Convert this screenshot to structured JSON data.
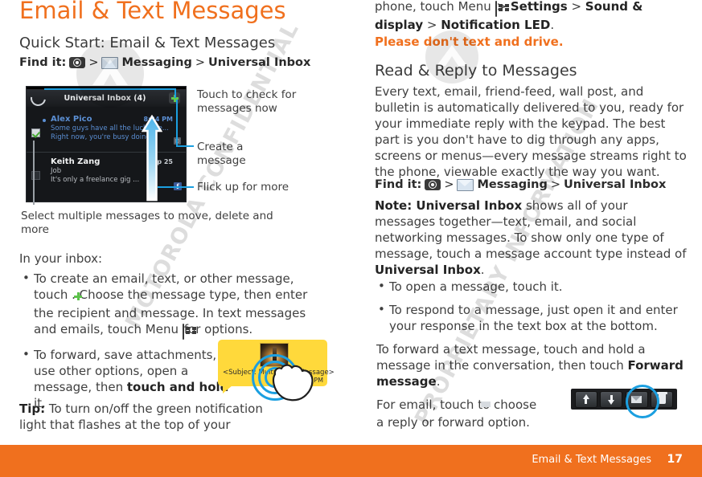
{
  "page": {
    "title": "Email & Text Messages",
    "subtitle": "Quick Start: Email & Text Messages",
    "accent_color": "#F0701E"
  },
  "left": {
    "find_it_label": "Find it:",
    "find_it_sep1": ">",
    "find_it_app": "Messaging",
    "find_it_sep2": ">",
    "find_it_target": "Universal Inbox",
    "phone": {
      "header_title": "Universal Inbox (4)",
      "refresh_icon": "refresh-icon",
      "compose_icon": "plus-icon",
      "messages": [
        {
          "from": "Alex Pico",
          "line2": "Some guys have all the luck, me...",
          "line3": "Right now, you're busy doing...",
          "time": "8:34 PM",
          "unread": true,
          "checked": true,
          "badge": "attachment-badge"
        },
        {
          "from": "Keith Zang",
          "line2": "Job",
          "line3": "It's only a freelance gig ...",
          "time": "Sep 25",
          "unread": false,
          "checked": false,
          "badge": "facebook-badge"
        }
      ]
    },
    "callouts": [
      "Touch to check for messages now",
      "Create a message",
      "Flick up for more",
      "Select multiple messages to move, delete and more"
    ],
    "inbox_intro": "In your inbox:",
    "bullets": [
      {
        "pre": "To create an email, text, or other message, touch ",
        "icon": "plus-icon",
        "mid": ". Choose the message type, then enter the recipient and message. In text messages and emails, touch Menu ",
        "icon2": "menu-icon",
        "post": " for options."
      },
      {
        "pre": "To forward, save attachments, or use other options, open a message, then ",
        "bold": "touch and hold",
        "post": " it."
      }
    ],
    "tip_label": "Tip:",
    "tip_text": " To turn on/off the green notification light that flashes at the top of your",
    "bubble": {
      "subject": "<Subject: Multimedia Message>",
      "time": "8:30 PM",
      "thumb": "lighthouse-thumbnail"
    }
  },
  "right": {
    "continued_pre": "phone, touch Menu ",
    "menu_icon": "menu-icon",
    "continued_sep1": " > ",
    "settings": "Settings",
    "continued_sep2": " > ",
    "sound_display": "Sound & display",
    "continued_sep3": " > ",
    "notification_led": "Notification LED",
    "continued_end": ".",
    "warning": "Please don't text and drive.",
    "section_title": "Read & Reply to Messages",
    "intro": "Every text, email, friend-feed, wall post, and bulletin is automatically delivered to you, ready for your immediate reply with the keypad. The best part is you don't have to dig through any apps, screens or menus—every message streams right to the phone, viewable exactly the way you want.",
    "find_it_label": "Find it:",
    "find_it_sep1": ">",
    "find_it_app": "Messaging",
    "find_it_sep2": ">",
    "find_it_target": "Universal Inbox",
    "note_label": "Note: Universal Inbox",
    "note_text": " shows all of your messages together—text, email, and social networking messages. To show only one type of message, touch a message account type instead of ",
    "note_bold_end": "Universal Inbox",
    "note_period": ".",
    "bullets": [
      {
        "text": "To open a message, touch it."
      },
      {
        "text": "To respond to a message, just open it and enter your response in the text box at the bottom."
      }
    ],
    "para_forward_pre": "To forward a text message, touch and hold a message in the conversation, then touch ",
    "para_forward_bold": "Forward message",
    "para_forward_post": ".",
    "para_email_pre": "For email, touch ",
    "para_email_icon": "reply-forward-icon",
    "para_email_post": " to choose a reply or forward option.",
    "toolbar": {
      "buttons": [
        "up-arrow-icon",
        "down-arrow-icon",
        "reply-forward-icon",
        "delete-trash-icon"
      ],
      "highlighted": "reply-forward-icon"
    }
  },
  "watermark": {
    "line1": "MOTOROLA CONFIDENTIAL",
    "line2": "PROPRIETARY INFORMATION"
  },
  "footer": {
    "section": "Email & Text Messages",
    "page_number": "17"
  }
}
